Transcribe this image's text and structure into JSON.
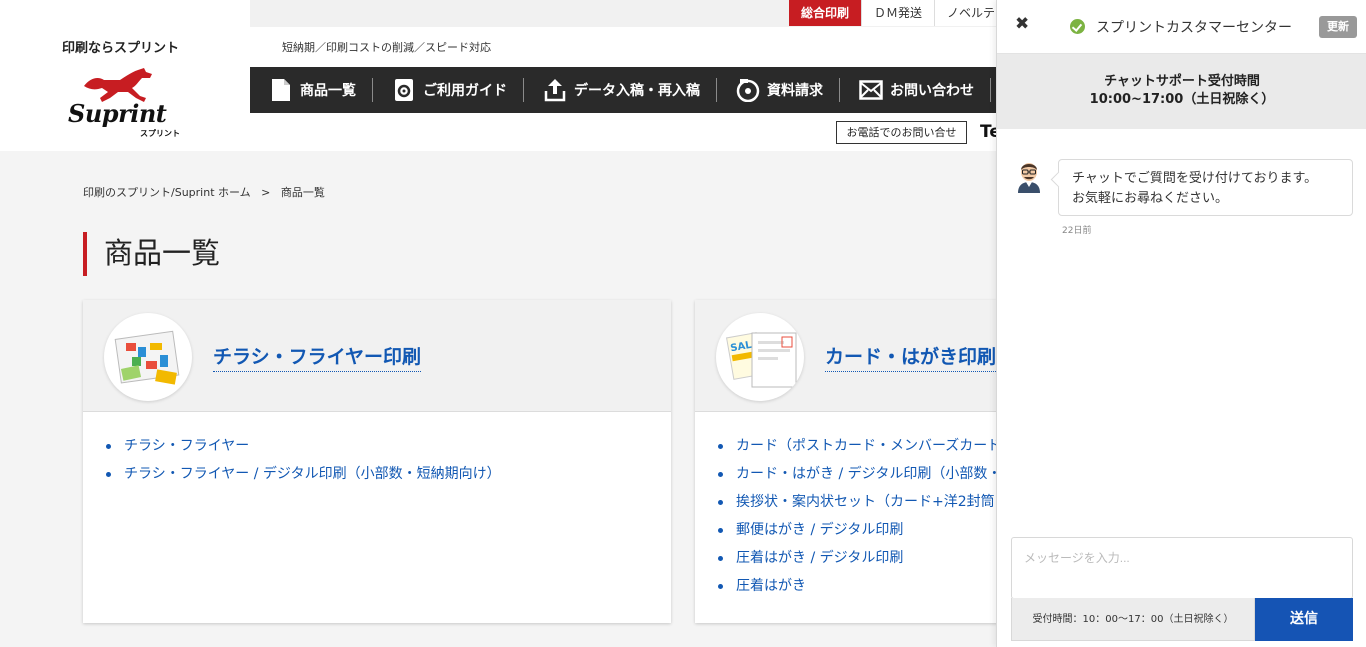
{
  "logo": {
    "tagline": "印刷ならスプリント",
    "wordmark": "Suprint",
    "kana": "スプリント"
  },
  "top_nav": [
    {
      "label": "総合印刷",
      "active": true
    },
    {
      "label": "ＤＭ発送",
      "active": false
    },
    {
      "label": "ノベルテ",
      "active": false
    }
  ],
  "sub_tagline": "短納期／印刷コストの削減／スピード対応",
  "main_nav": [
    {
      "label": "商品一覧",
      "icon": "document-icon"
    },
    {
      "label": "ご利用ガイド",
      "icon": "gear-icon"
    },
    {
      "label": "データ入稿・再入稿",
      "icon": "upload-icon"
    },
    {
      "label": "資料請求",
      "icon": "disc-icon"
    },
    {
      "label": "お問い合わせ",
      "icon": "mail-icon"
    }
  ],
  "phone_contact": {
    "button_label": "お電話でのお問い合せ",
    "cut_text": "Te"
  },
  "breadcrumb": {
    "home": "印刷のスプリント/Suprint ホーム",
    "separator": ">",
    "current": "商品一覧"
  },
  "page_title": "商品一覧",
  "cards": [
    {
      "title": "チラシ・フライヤー印刷",
      "items": [
        "チラシ・フライヤー",
        "チラシ・フライヤー / デジタル印刷（小部数・短納期向け）"
      ]
    },
    {
      "title": "カード・はがき印刷",
      "items": [
        "カード（ポストカード・メンバーズカード",
        "カード・はがき / デジタル印刷（小部数・",
        "挨拶状・案内状セット（カード+洋2封筒",
        "郵便はがき / デジタル印刷",
        "圧着はがき / デジタル印刷",
        "圧着はがき"
      ]
    }
  ],
  "chat": {
    "close_symbol": "✖",
    "agent_name": "スプリントカスタマーセンター",
    "refresh_label": "更新",
    "hours_title": "チャットサポート受付時間",
    "hours_value": "10:00~17:00（土日祝除く）",
    "message_line1": "チャットでご質問を受け付けております。",
    "message_line2": "お気軽にお尋ねください。",
    "message_time": "22日前",
    "input_placeholder": "メッセージを入力...",
    "footer_hours": "受付時間：10：00〜17：00（土日祝除く）",
    "send_label": "送信"
  },
  "colors": {
    "brand_red": "#c71d22",
    "nav_dark": "#2a2a2a",
    "link_blue": "#1258b3",
    "send_blue": "#1554b4",
    "online_green": "#7cb342"
  }
}
